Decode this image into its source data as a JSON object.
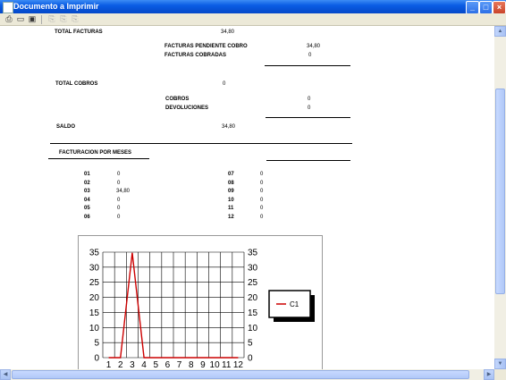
{
  "window": {
    "title": "Documento a Imprimir"
  },
  "toolbar": {
    "icons": [
      "print-icon",
      "printer-setup-icon",
      "page-view-icon",
      "prev-page-icon",
      "page-icon",
      "next-page-icon"
    ]
  },
  "report": {
    "total_facturas_label": "TOTAL FACTURAS",
    "total_facturas_value": "34,80",
    "pendiente_label": "FACTURAS PENDIENTE COBRO",
    "pendiente_value": "34,80",
    "cobradas_label": "FACTURAS COBRADAS",
    "cobradas_value": "0",
    "total_cobros_label": "TOTAL COBROS",
    "total_cobros_value": "0",
    "cobros_label": "COBROS",
    "cobros_value": "0",
    "devoluciones_label": "DEVOLUCIONES",
    "devoluciones_value": "0",
    "saldo_label": "SALDO",
    "saldo_value": "34,80",
    "meses_title": "FACTURACION POR MESES",
    "months_left": [
      {
        "month": "01",
        "value": "0"
      },
      {
        "month": "02",
        "value": "0"
      },
      {
        "month": "03",
        "value": "34,80"
      },
      {
        "month": "04",
        "value": "0"
      },
      {
        "month": "05",
        "value": "0"
      },
      {
        "month": "06",
        "value": "0"
      }
    ],
    "months_right": [
      {
        "month": "07",
        "value": "0"
      },
      {
        "month": "08",
        "value": "0"
      },
      {
        "month": "09",
        "value": "0"
      },
      {
        "month": "10",
        "value": "0"
      },
      {
        "month": "11",
        "value": "0"
      },
      {
        "month": "12",
        "value": "0"
      }
    ]
  },
  "chart_data": {
    "type": "line",
    "x": [
      1,
      2,
      3,
      4,
      5,
      6,
      7,
      8,
      9,
      10,
      11,
      12
    ],
    "series": [
      {
        "name": "C1",
        "values": [
          0,
          0,
          34.8,
          0,
          0,
          0,
          0,
          0,
          0,
          0,
          0,
          0
        ],
        "color": "#cc0000"
      }
    ],
    "yticks": [
      0,
      5,
      10,
      15,
      20,
      25,
      30,
      35
    ],
    "ylim": [
      0,
      35
    ],
    "grid": true,
    "legend_position": "right"
  }
}
